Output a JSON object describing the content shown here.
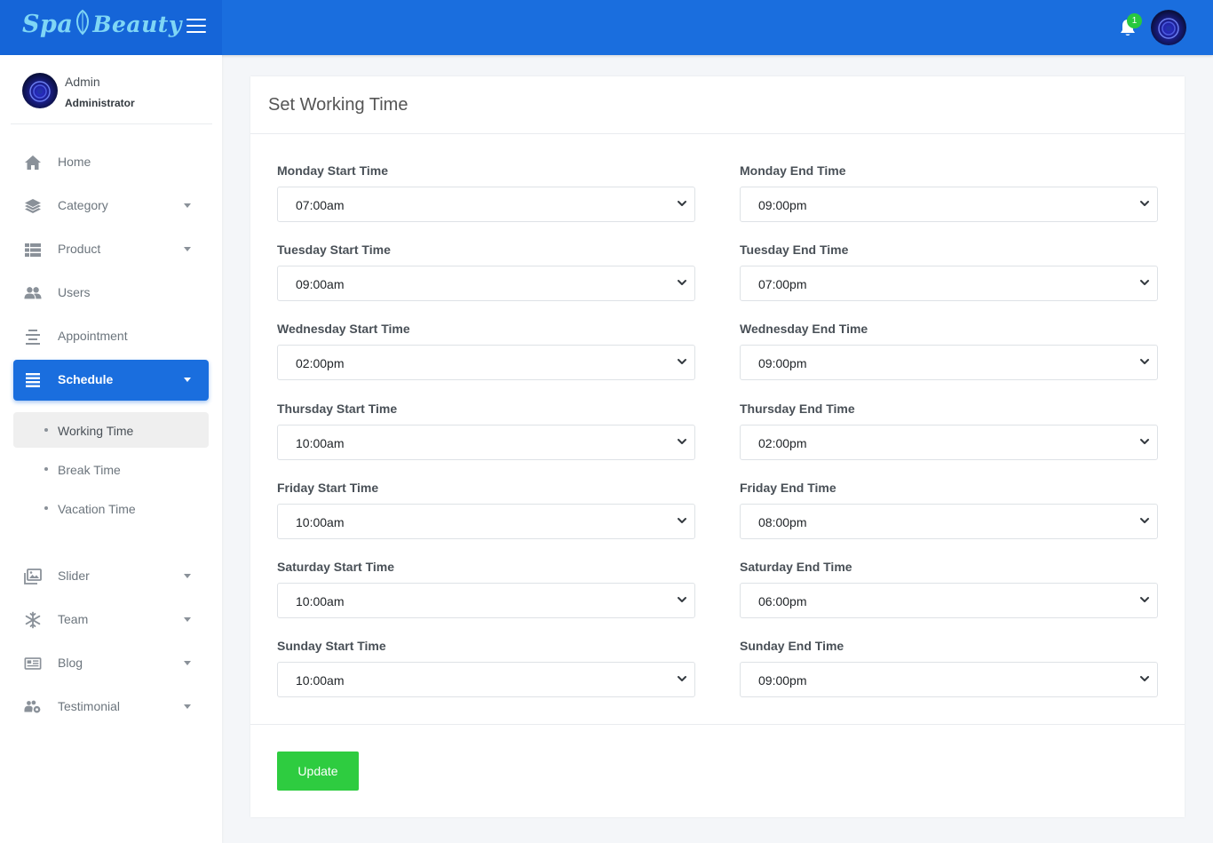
{
  "brand": {
    "word1": "Spa",
    "word2": "Beauty"
  },
  "header": {
    "notification_count": "1"
  },
  "user": {
    "name": "Admin",
    "role": "Administrator"
  },
  "sidebar": {
    "items": [
      {
        "label": "Home",
        "icon": "home-icon"
      },
      {
        "label": "Category",
        "icon": "layers-icon"
      },
      {
        "label": "Product",
        "icon": "table-list-icon"
      },
      {
        "label": "Users",
        "icon": "users-icon"
      },
      {
        "label": "Appointment",
        "icon": "align-center-icon"
      },
      {
        "label": "Schedule",
        "icon": "list-icon"
      },
      {
        "label": "Slider",
        "icon": "images-icon"
      },
      {
        "label": "Team",
        "icon": "snowflake-icon"
      },
      {
        "label": "Blog",
        "icon": "newspaper-icon"
      },
      {
        "label": "Testimonial",
        "icon": "users-gear-icon"
      }
    ],
    "schedule_sub": [
      {
        "label": "Working Time"
      },
      {
        "label": "Break Time"
      },
      {
        "label": "Vacation Time"
      }
    ]
  },
  "form": {
    "title": "Set Working Time",
    "days": [
      {
        "start_label": "Monday Start Time",
        "start": "07:00am",
        "end_label": "Monday End Time",
        "end": "09:00pm"
      },
      {
        "start_label": "Tuesday Start Time",
        "start": "09:00am",
        "end_label": "Tuesday End Time",
        "end": "07:00pm"
      },
      {
        "start_label": "Wednesday Start Time",
        "start": "02:00pm",
        "end_label": "Wednesday End Time",
        "end": "09:00pm"
      },
      {
        "start_label": "Thursday Start Time",
        "start": "10:00am",
        "end_label": "Thursday End Time",
        "end": "02:00pm"
      },
      {
        "start_label": "Friday Start Time",
        "start": "10:00am",
        "end_label": "Friday End Time",
        "end": "08:00pm"
      },
      {
        "start_label": "Saturday Start Time",
        "start": "10:00am",
        "end_label": "Saturday End Time",
        "end": "06:00pm"
      },
      {
        "start_label": "Sunday Start Time",
        "start": "10:00am",
        "end_label": "Sunday End Time",
        "end": "09:00pm"
      }
    ],
    "submit_label": "Update"
  },
  "colors": {
    "primary": "#1a6ede",
    "success": "#2ecc40"
  }
}
